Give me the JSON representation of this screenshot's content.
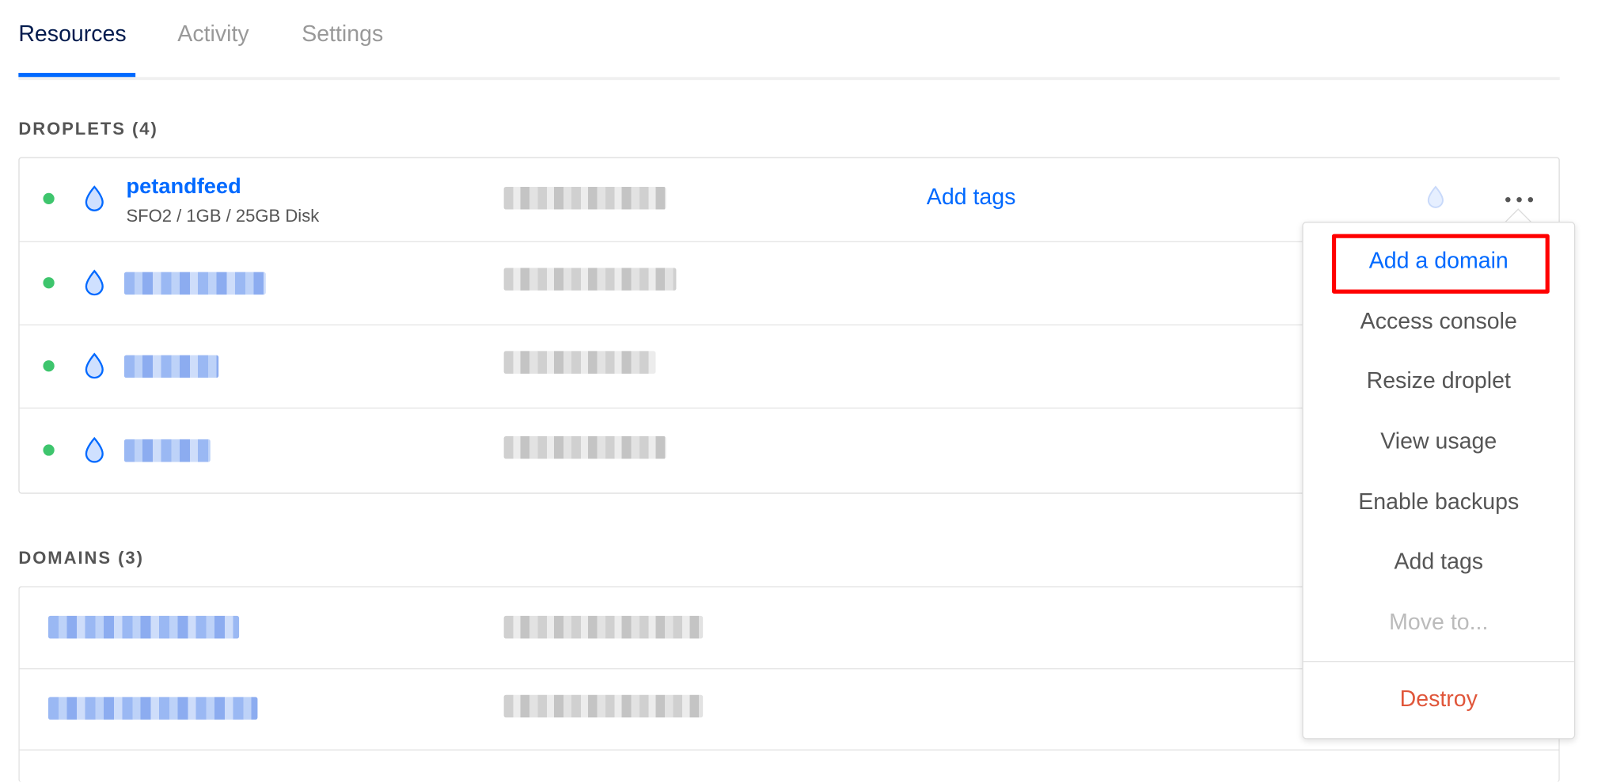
{
  "tabs": [
    {
      "label": "Resources",
      "active": true
    },
    {
      "label": "Activity",
      "active": false
    },
    {
      "label": "Settings",
      "active": false
    }
  ],
  "droplets": {
    "title": "DROPLETS (4)",
    "items": [
      {
        "name": "petandfeed",
        "meta": "SFO2 / 1GB / 25GB Disk",
        "tags_label": "Add tags",
        "status": "active"
      },
      {
        "name": "",
        "status": "active"
      },
      {
        "name": "",
        "status": "active"
      },
      {
        "name": "",
        "status": "active"
      }
    ]
  },
  "domains": {
    "title": "DOMAINS (3)"
  },
  "menu": {
    "items": [
      {
        "label": "Add a domain",
        "style": "primary"
      },
      {
        "label": "Access console",
        "style": "normal"
      },
      {
        "label": "Resize droplet",
        "style": "normal"
      },
      {
        "label": "View usage",
        "style": "normal"
      },
      {
        "label": "Enable backups",
        "style": "normal"
      },
      {
        "label": "Add tags",
        "style": "normal"
      },
      {
        "label": "Move to...",
        "style": "disabled"
      },
      {
        "label": "Destroy",
        "style": "danger"
      }
    ]
  },
  "colors": {
    "accent": "#0069ff",
    "status_active": "#3ec56d",
    "danger": "#e0563a",
    "highlight": "#ff0000"
  }
}
